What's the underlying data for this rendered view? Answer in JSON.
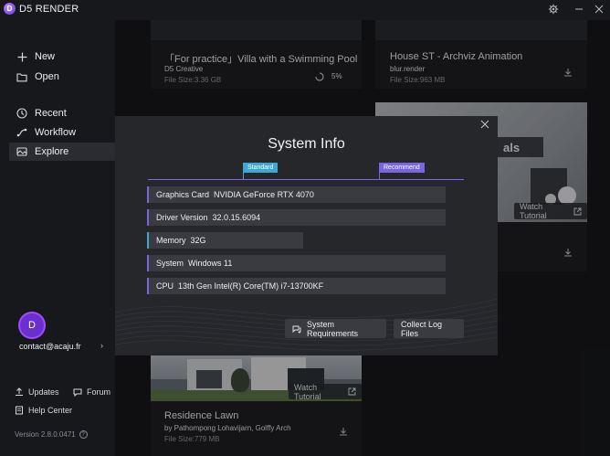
{
  "app": {
    "title": "D5 RENDER",
    "logo_letter": "D"
  },
  "window_controls": [
    {
      "name": "settings-icon"
    },
    {
      "name": "minimize-icon"
    },
    {
      "name": "close-icon"
    }
  ],
  "sidebar": {
    "items": [
      {
        "label": "New",
        "icon": "plus-icon"
      },
      {
        "label": "Open",
        "icon": "folder-icon"
      },
      {
        "label": "Recent",
        "icon": "clock-icon"
      },
      {
        "label": "Workflow",
        "icon": "workflow-icon"
      },
      {
        "label": "Explore",
        "icon": "explore-icon",
        "active": true
      }
    ],
    "account": {
      "avatar_letter": "D",
      "email": "contact@acaju.fr"
    },
    "footer": {
      "updates": "Updates",
      "forum": "Forum",
      "help_center": "Help Center",
      "version": "Version 2.8.0.0471"
    }
  },
  "cards": [
    {
      "title": "「For practice」Villa with a Swimming Pool",
      "author": "D5 Creative",
      "size": "File Size:3.36 GB",
      "progress": "5%"
    },
    {
      "title": "House ST - Archviz Animation",
      "author": "blur.render",
      "size": "File Size:963 MB"
    },
    {
      "title": "Residence Lawn",
      "author": "by Pathompong Lohavijarn, Golffy Arch",
      "size": "File Size:779 MB",
      "tutorial": "Watch Tutorial"
    },
    {
      "partial_text": "als",
      "tutorial": "Watch Tutorial"
    }
  ],
  "system_info": {
    "title": "System Info",
    "legend": {
      "standard": "Standard",
      "recommend": "Recommend"
    },
    "rows": [
      {
        "label": "Graphics Card",
        "value": "NVIDIA GeForce RTX 4070",
        "status": "recommend"
      },
      {
        "label": "Driver Version",
        "value": "32.0.15.6094",
        "status": "recommend"
      },
      {
        "label": "Memory",
        "value": "32G",
        "status": "standard"
      },
      {
        "label": "System",
        "value": "Windows 11",
        "status": "recommend"
      },
      {
        "label": "CPU",
        "value": "13th Gen Intel(R) Core(TM) i7-13700KF",
        "status": "recommend"
      }
    ],
    "buttons": {
      "requirements": "System Requirements",
      "logs": "Collect Log Files"
    }
  },
  "colors": {
    "accent_purple": "#7a64e6",
    "accent_blue": "#3da7d6",
    "background": "#17181c",
    "panel": "#26272b"
  }
}
